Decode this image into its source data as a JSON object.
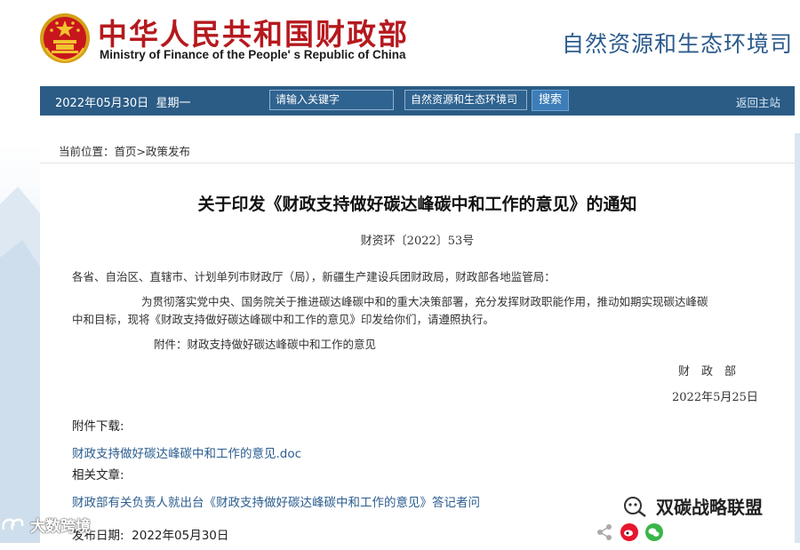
{
  "header": {
    "ministry_cn": "中华人民共和国财政部",
    "ministry_en": "Ministry of Finance of the People' s Republic of China",
    "department": "自然资源和生态环境司"
  },
  "navbar": {
    "date": "2022年05月30日",
    "weekday": "星期一",
    "search_placeholder": "请输入关键字",
    "scope": "自然资源和生态环境司",
    "search_button": "搜索",
    "home_link": "返回主站"
  },
  "breadcrumb": {
    "prefix": "当前位置：",
    "home": "首页",
    "separator": ">",
    "section": "政策发布"
  },
  "document": {
    "title": "关于印发《财政支持做好碳达峰碳中和工作的意见》的通知",
    "number": "财资环〔2022〕53号",
    "addressee": "各省、自治区、直辖市、计划单列市财政厅（局），新疆生产建设兵团财政局，财政部各地监管局：",
    "para1_line1": "为贯彻落实党中央、国务院关于推进碳达峰碳中和的重大决策部署，充分发挥财政职能作用，推动如期实现碳达峰碳",
    "para1_line2": "中和目标，现将《财政支持做好碳达峰碳中和工作的意见》印发给你们，请遵照执行。",
    "attachment": "附件：财政支持做好碳达峰碳中和工作的意见",
    "signer": "财　政　部",
    "sign_date": "2022年5月25日"
  },
  "downloads": {
    "label": "附件下载:",
    "file": "财政支持做好碳达峰碳中和工作的意见.doc"
  },
  "related": {
    "label": "相关文章:",
    "article": "财政部有关负责人就出台《财政支持做好碳达峰碳中和工作的意见》答记者问"
  },
  "publish": {
    "label": "发布日期:",
    "date": "2022年05月30日"
  },
  "watermark": {
    "left": "大数跨境",
    "right": "双碳战略联盟"
  },
  "colors": {
    "brand_red": "#b5191e",
    "nav_blue": "#2b5c86",
    "link_blue": "#2b5d8f"
  }
}
